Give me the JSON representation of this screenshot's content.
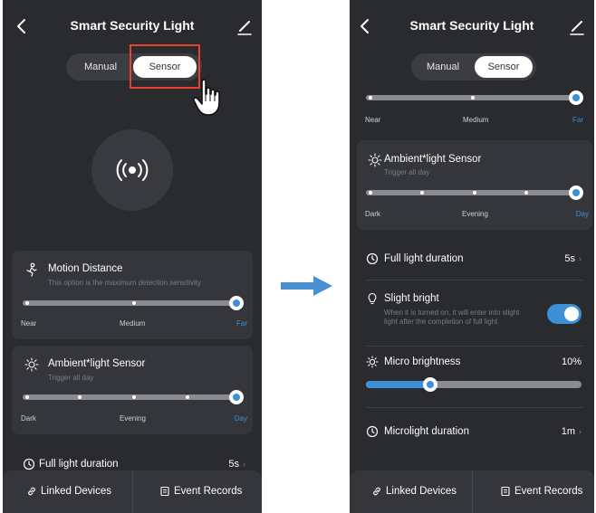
{
  "colors": {
    "background": "#292b2f",
    "card": "#34363b",
    "accent": "#3d8fd6",
    "highlight": "#e8402c"
  },
  "screen_a": {
    "title": "Smart Security Light",
    "mode_tabs": {
      "manual": "Manual",
      "sensor": "Sensor",
      "selected": "Sensor"
    },
    "motion_distance": {
      "title": "Motion Distance",
      "subtitle": "This option is the maximum detection sensitivity",
      "labels": {
        "low": "Near",
        "mid": "Medium",
        "high": "Far"
      },
      "level": "Far"
    },
    "ambient_sensor": {
      "title": "Ambient*light Sensor",
      "subtitle": "Trigger all day",
      "labels": {
        "low": "Dark",
        "mid": "Evening",
        "high": "Day"
      },
      "level": "Day"
    },
    "full_light_duration": {
      "label": "Full light duration",
      "value": "5s"
    },
    "bottom_bar": {
      "linked_devices": "Linked Devices",
      "event_records": "Event Records"
    }
  },
  "screen_b": {
    "title": "Smart Security Light",
    "mode_tabs": {
      "manual": "Manual",
      "sensor": "Sensor",
      "selected": "Sensor"
    },
    "distance_labels": {
      "low": "Near",
      "mid": "Medium",
      "high": "Far"
    },
    "ambient_sensor": {
      "title": "Ambient*light Sensor",
      "subtitle": "Trigger all day",
      "labels": {
        "low": "Dark",
        "mid": "Evening",
        "high": "Day"
      },
      "level": "Day"
    },
    "full_light_duration": {
      "label": "Full light duration",
      "value": "5s"
    },
    "slight_bright": {
      "label": "Slight bright",
      "description": "When it is turned on, it will enter into slight light after the completion of full light",
      "enabled": true
    },
    "micro_brightness": {
      "label": "Micro brightness",
      "value": "10%",
      "percent": 10
    },
    "microlight_duration": {
      "label": "Microlight duration",
      "value": "1m"
    },
    "bottom_bar": {
      "linked_devices": "Linked Devices",
      "event_records": "Event Records"
    }
  },
  "icons": {
    "back": "chevron-left-icon",
    "edit": "edit-pencil-icon",
    "sensor": "signal-waves-icon",
    "motion": "motion-icon",
    "sun": "sun-icon",
    "clock": "clock-icon",
    "bulb": "bulb-icon",
    "link": "link-icon",
    "records": "records-icon",
    "cursor": "hand-pointer-icon",
    "transition": "arrow-right-icon"
  }
}
